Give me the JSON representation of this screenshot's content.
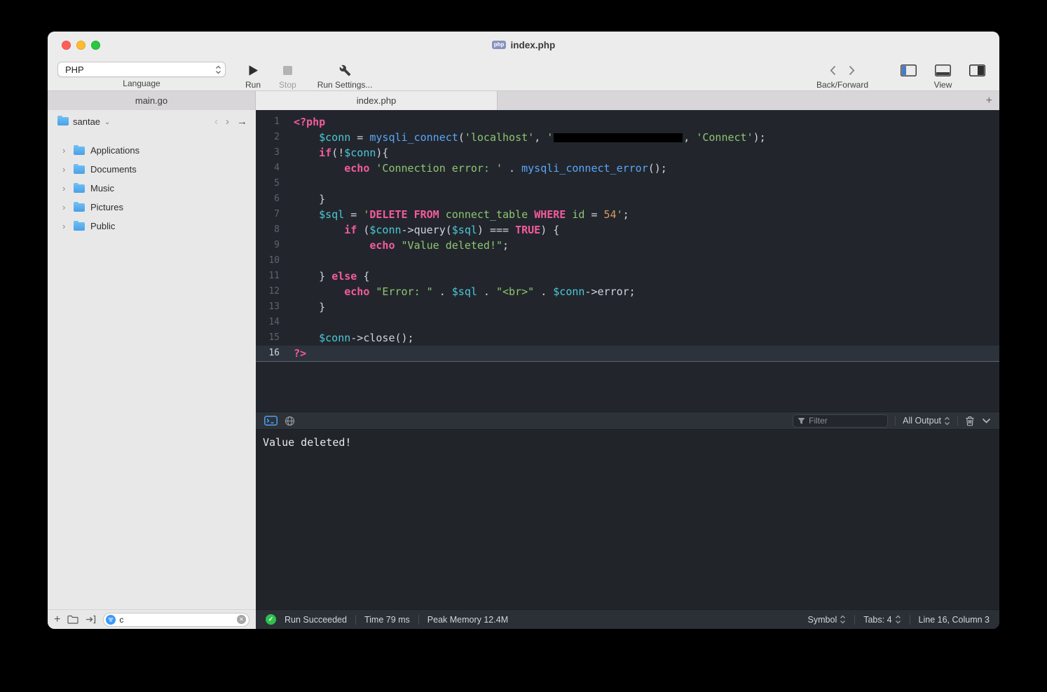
{
  "window": {
    "title": "index.php"
  },
  "icons": {
    "add": "+",
    "disclosure": "›",
    "caret_down": "⌄",
    "chevron_left": "‹",
    "chevron_right": "›",
    "arrow_right": "→",
    "clear": "✕",
    "check": "✓"
  },
  "toolbar": {
    "language_value": "PHP",
    "language_label": "Language",
    "run_label": "Run",
    "stop_label": "Stop",
    "run_settings_label": "Run Settings...",
    "back_forward_label": "Back/Forward",
    "view_label": "View"
  },
  "tabbar": {
    "tabs": [
      {
        "label": "main.go",
        "active": false
      },
      {
        "label": "index.php",
        "active": true
      }
    ]
  },
  "sidebar": {
    "root_label": "santae",
    "items": [
      {
        "label": "Applications"
      },
      {
        "label": "Documents"
      },
      {
        "label": "Music"
      },
      {
        "label": "Pictures"
      },
      {
        "label": "Public"
      }
    ],
    "search_value": "c"
  },
  "editor": {
    "active_line": 16,
    "lines": [
      [
        [
          "t",
          "<?php"
        ]
      ],
      [
        [
          "p",
          "    "
        ],
        [
          "v",
          "$conn"
        ],
        [
          "p",
          " = "
        ],
        [
          "f",
          "mysqli_connect"
        ],
        [
          "p",
          "("
        ],
        [
          "s",
          "'localhost'"
        ],
        [
          "p",
          ", "
        ],
        [
          "s",
          "'"
        ],
        [
          "r",
          ""
        ],
        [
          "p",
          ", "
        ],
        [
          "s",
          "'Connect'"
        ],
        [
          "p",
          ");"
        ]
      ],
      [
        [
          "p",
          "    "
        ],
        [
          "k",
          "if"
        ],
        [
          "p",
          "(!"
        ],
        [
          "v",
          "$conn"
        ],
        [
          "p",
          "){"
        ]
      ],
      [
        [
          "p",
          "        "
        ],
        [
          "k",
          "echo"
        ],
        [
          "p",
          " "
        ],
        [
          "s",
          "'Connection error: '"
        ],
        [
          "p",
          " . "
        ],
        [
          "f",
          "mysqli_connect_error"
        ],
        [
          "p",
          "();"
        ]
      ],
      [],
      [
        [
          "p",
          "    }"
        ]
      ],
      [
        [
          "p",
          "    "
        ],
        [
          "v",
          "$sql"
        ],
        [
          "p",
          " = "
        ],
        [
          "s",
          "'"
        ],
        [
          "k",
          "DELETE FROM"
        ],
        [
          "s",
          " connect_table "
        ],
        [
          "k",
          "WHERE"
        ],
        [
          "s",
          " id "
        ],
        [
          "p",
          "= "
        ],
        [
          "n",
          "54"
        ],
        [
          "s",
          "'"
        ],
        [
          "p",
          ";"
        ]
      ],
      [
        [
          "p",
          "        "
        ],
        [
          "k",
          "if"
        ],
        [
          "p",
          " ("
        ],
        [
          "v",
          "$conn"
        ],
        [
          "p",
          "->query("
        ],
        [
          "v",
          "$sql"
        ],
        [
          "p",
          ") === "
        ],
        [
          "k",
          "TRUE"
        ],
        [
          "p",
          ") {"
        ]
      ],
      [
        [
          "p",
          "            "
        ],
        [
          "k",
          "echo"
        ],
        [
          "p",
          " "
        ],
        [
          "s",
          "\"Value deleted!\""
        ],
        [
          "p",
          ";"
        ]
      ],
      [],
      [
        [
          "p",
          "    } "
        ],
        [
          "k",
          "else"
        ],
        [
          "p",
          " {"
        ]
      ],
      [
        [
          "p",
          "        "
        ],
        [
          "k",
          "echo"
        ],
        [
          "p",
          " "
        ],
        [
          "s",
          "\"Error: \""
        ],
        [
          "p",
          " . "
        ],
        [
          "v",
          "$sql"
        ],
        [
          "p",
          " . "
        ],
        [
          "s",
          "\"<br>\""
        ],
        [
          "p",
          " . "
        ],
        [
          "v",
          "$conn"
        ],
        [
          "p",
          "->error;"
        ]
      ],
      [
        [
          "p",
          "    }"
        ]
      ],
      [],
      [
        [
          "p",
          "    "
        ],
        [
          "v",
          "$conn"
        ],
        [
          "p",
          "->close();"
        ]
      ],
      [
        [
          "t",
          "?>"
        ]
      ]
    ]
  },
  "console": {
    "filter_placeholder": "Filter",
    "output_select": "All Output",
    "output_text": "Value deleted!"
  },
  "statusbar": {
    "run_status": "Run Succeeded",
    "time": "Time 79 ms",
    "memory": "Peak Memory 12.4M",
    "symbol_label": "Symbol",
    "tabs_label": "Tabs: 4",
    "position_label": "Line 16, Column 3"
  }
}
